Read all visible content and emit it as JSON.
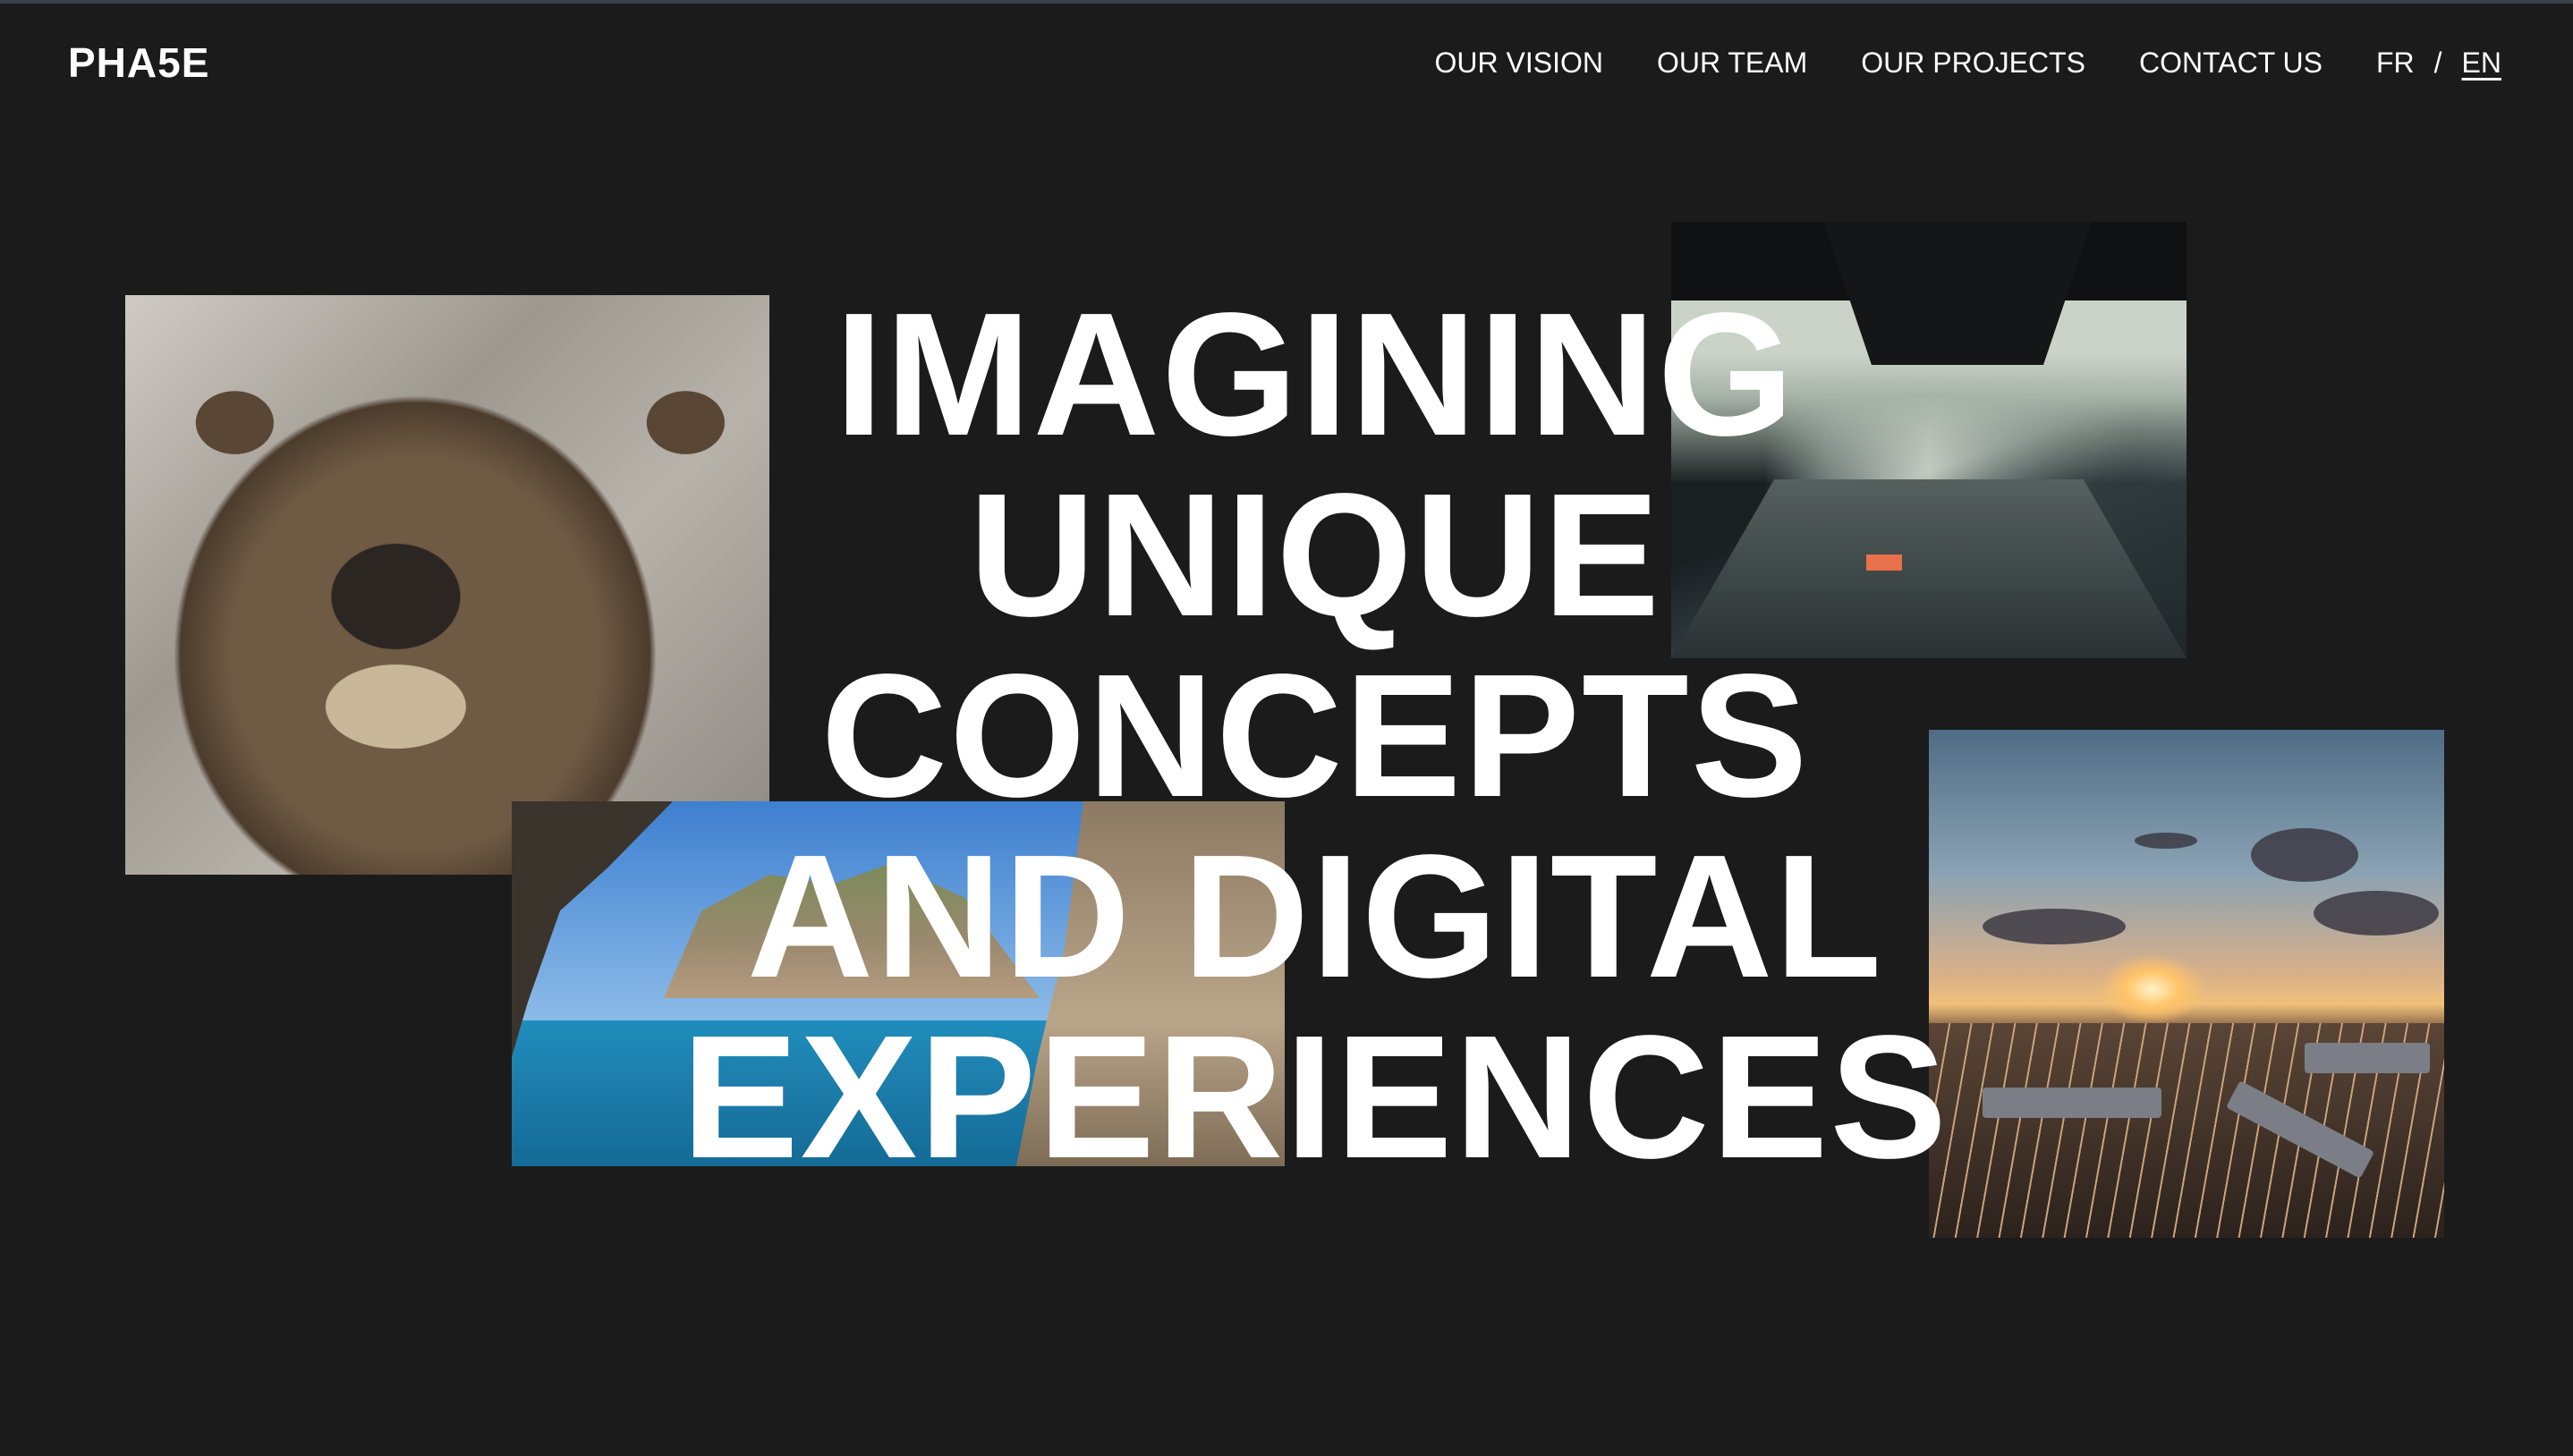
{
  "header": {
    "logo": "PHA5E",
    "nav": [
      {
        "label": "OUR VISION"
      },
      {
        "label": "OUR TEAM"
      },
      {
        "label": "OUR PROJECTS"
      },
      {
        "label": "CONTACT US"
      }
    ],
    "languages": {
      "fr": "FR",
      "separator": "/",
      "en": "EN",
      "active": "EN"
    }
  },
  "hero": {
    "lines": [
      "IMAGINING",
      "UNIQUE",
      "CONCEPTS",
      "AND DIGITAL",
      "EXPERIENCES"
    ]
  },
  "colors": {
    "background": "#1b1b1b",
    "text": "#ffffff"
  }
}
